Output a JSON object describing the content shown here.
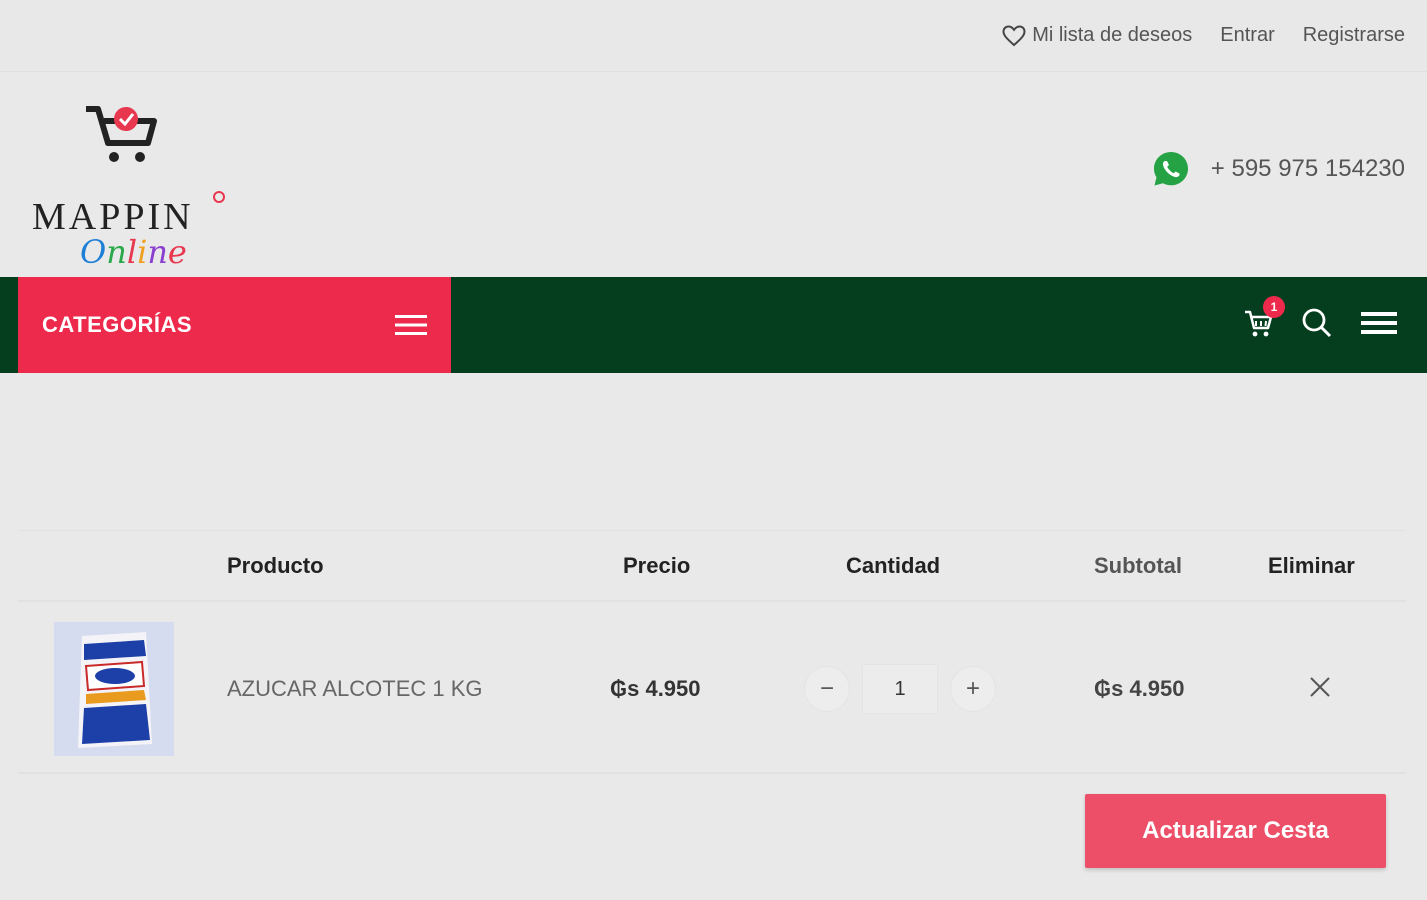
{
  "topbar": {
    "wishlist_label": "Mi lista de deseos",
    "login_label": "Entrar",
    "register_label": "Registrarse"
  },
  "header": {
    "logo_word": "MAPPIN",
    "logo_script": "Online",
    "phone": "+ 595 975 154230"
  },
  "nav": {
    "categories_label": "CATEGORÍAS",
    "cart_count": "1"
  },
  "cart": {
    "headers": {
      "product": "Producto",
      "price": "Precio",
      "quantity": "Cantidad",
      "subtotal": "Subtotal",
      "remove": "Eliminar"
    },
    "items": [
      {
        "name": "AZUCAR ALCOTEC 1 KG",
        "price": "₲s 4.950",
        "quantity": "1",
        "subtotal": "₲s 4.950",
        "decrement": "−",
        "increment": "+"
      }
    ],
    "update_label": "Actualizar Cesta"
  },
  "colors": {
    "brand_red": "#ee2a4c",
    "nav_green": "#053d1f",
    "update_button": "#ee4f68",
    "whatsapp": "#25a244"
  }
}
